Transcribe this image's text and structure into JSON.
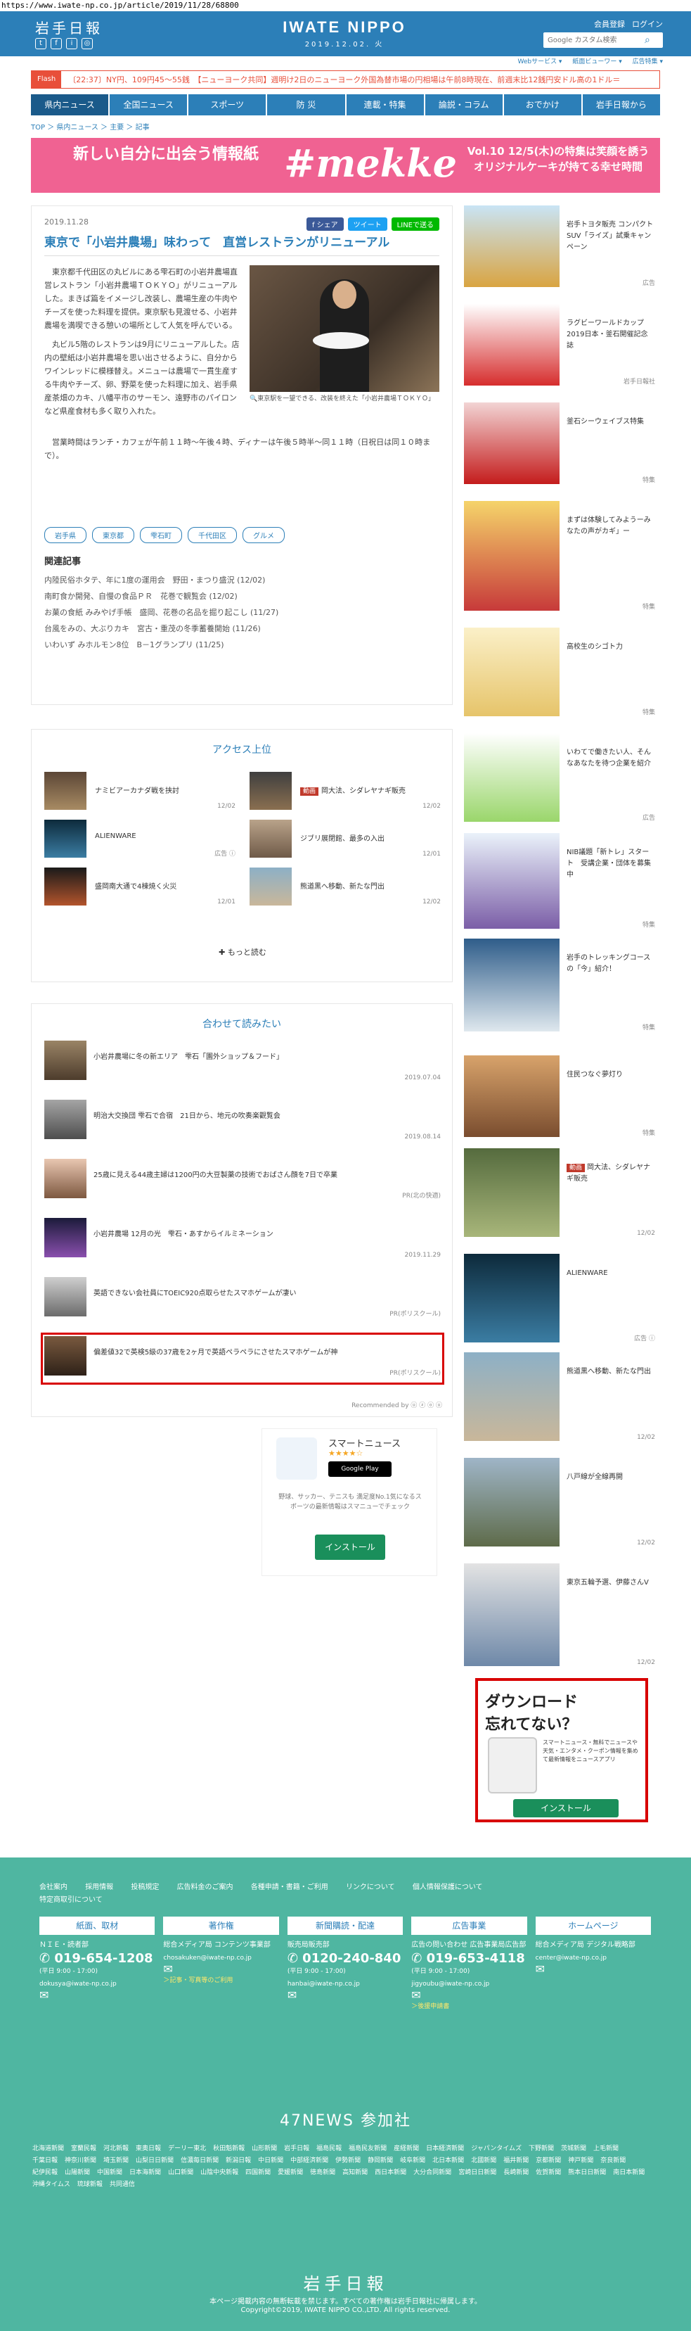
{
  "url": "https://www.iwate-np.co.jp/article/2019/11/28/68800",
  "header": {
    "logo_jp": "岩手日報",
    "brand": "IWATE NIPPO",
    "date": "2019.12.02. 火",
    "member_register": "会員登録",
    "login": "ログイン",
    "search_placeholder": "Google カスタム検索",
    "social": [
      "t",
      "f",
      "i",
      "◎"
    ]
  },
  "topline": [
    "Webサービス ▾",
    "紙面ビューワー ▾",
    "広告特集 ▾"
  ],
  "flash": {
    "tag": "Flash",
    "text": "〔22:37〕NY円、109円45～55銭　【ニューヨーク共同】週明け2日のニューヨーク外国為替市場の円相場は午前8時現在、前週末比12銭円安ドル高の1ドル＝"
  },
  "nav": [
    "県内ニュース",
    "全国ニュース",
    "スポーツ",
    "防 災",
    "連載・特集",
    "論説・コラム",
    "おでかけ",
    "岩手日報から"
  ],
  "breadcrumb": "TOP ＞ 県内ニュース ＞ 主要 ＞ 記事",
  "banner": {
    "left": "新しい自分に出会う情報紙",
    "mid": "#mekke",
    "right": "Vol.10 12/5(木)の特集は笑顔を誘うオリジナルケーキが持てる幸せ時間"
  },
  "article": {
    "date": "2019.11.28",
    "share": [
      "f シェア",
      "ツイート",
      "LINEで送る"
    ],
    "title": "東京で「小岩井農場」味わって　直営レストランがリニューアル",
    "paragraphs": [
      "東京都千代田区の丸ビルにある雫石町の小岩井農場直営レストラン「小岩井農場ＴＯＫＹＯ」がリニューアルした。まきば篇をイメージし改装し、農場生産の牛肉やチーズを使った料理を提供。東京駅も見渡せる、小岩井農場を満喫できる憩いの場所として人気を呼んでいる。",
      "丸ビル5階のレストランは9月にリニューアルした。店内の壁紙は小岩井農場を思い出させるように、自分からワインレッドに模様替え。メニューは農場で一貫生産する牛肉やチーズ、卵、野菜を使った料理に加え、岩手県産茶畑のカキ、八幡平市のサーモン、遠野市のパイロンなど県産食材も多く取り入れた。"
    ],
    "paragraph3": "営業時間はランチ・カフェが午前１１時～午後４時、ディナーは午後５時半～同１１時（日祝日は同１０時まで）。",
    "caption": "東京駅を一望できる、改装を終えた「小岩井農場ＴＯＫＹＯ」",
    "tags": [
      "岩手県",
      "東京都",
      "雫石町",
      "千代田区",
      "グルメ"
    ],
    "related_heading": "関連記事",
    "related": [
      "内陸民俗ホタテ、年に1度の運用会　野田・まつり盛況 (12/02)",
      "南町食か開発、自慢の食品ＰＲ　花巻で観覧会 (12/02)",
      "お菓の食紙 みみやげ手帳　盛岡、花巻の名品を掘り起こし (11/27)",
      "台風をみの、大ぶりカキ　宮古・重茂の冬季蓄養開始 (11/26)",
      "いわいず みホルモン8位　B－1グランプリ (11/25)"
    ]
  },
  "access": {
    "title": "アクセス上位",
    "items": [
      {
        "text": "ナミビアーカナダ戦を挟討",
        "date": "12/02",
        "hot": ""
      },
      {
        "text": "岡大法、シダレヤナギ販売",
        "date": "12/02",
        "hot": "動画"
      },
      {
        "text": "ALIENWARE",
        "date": "広告 ⓘ",
        "hot": ""
      },
      {
        "text": "ジブリ展閉館、最多の入出",
        "date": "12/01",
        "hot": ""
      },
      {
        "text": "盛岡南大通で4棟焼く火災",
        "date": "12/01",
        "hot": ""
      },
      {
        "text": "熊道黒へ移動、新たな門出",
        "date": "12/02",
        "hot": ""
      }
    ],
    "more": "✚ もっと読む"
  },
  "together": {
    "title": "合わせて読みたい",
    "rows": [
      {
        "text": "小岩井農場に冬の新エリア　雫石「園外ショップ＆フード」",
        "date": "2019.07.04"
      },
      {
        "text": "明治大交換団 雫石で合宿　21日から、地元の吹奏楽觀覧会",
        "date": "2019.08.14"
      },
      {
        "text": "25歳に見える44歳主婦は1200円の大豆製薬の技術でおばさん顔を7日で卒業",
        "date": "PR(北の快適)"
      },
      {
        "text": "小岩井農場 12月の光　雫石・あすからイルミネーション",
        "date": "2019.11.29"
      },
      {
        "text": "英語できない会社員にTOEIC920点取らせたスマホゲームが凄い",
        "date": "PR(ポリスクール)"
      },
      {
        "text": "偏差値32で英検5級の37歳を2ヶ月で英語ペラペラにさせたスマホゲームが神",
        "date": "PR(ポリスクール)"
      }
    ],
    "recommended": "Recommended by ⓤ ⓩ ⓞ ⓤ"
  },
  "appad": {
    "name": "スマートニュース",
    "stars": "★★★★☆",
    "store": "Google Play",
    "desc": "野球、サッカー、テニスも 満足度No.1気になるスポーツの最新情報はスマニューでチェック",
    "install": "インストール"
  },
  "sidebar": [
    {
      "text": "岩手トヨタ販売 コンパクトSUV「ライズ」試乗キャンペーン",
      "src": "広告",
      "hot": ""
    },
    {
      "text": "ラグビーワールドカップ2019日本・釜石開催記念誌",
      "src": "岩手日報社",
      "hot": ""
    },
    {
      "text": "釜石シーウェイブス特集",
      "src": "特集",
      "hot": ""
    },
    {
      "text": "まずは体験してみようーみなたの声がカギ」ー",
      "src": "特集",
      "hot": ""
    },
    {
      "text": "高校生のシゴト力",
      "src": "特集",
      "hot": ""
    },
    {
      "text": "いわてで働きたい人、そんなあなたを待つ企業を紹介",
      "src": "広告",
      "hot": ""
    },
    {
      "text": "NIB議題「新トレ」スタート　受講企業・団体を募集中",
      "src": "特集",
      "hot": ""
    },
    {
      "text": "岩手のトレッキングコースの「今」紹介！",
      "src": "特集",
      "hot": ""
    },
    {
      "text": "住民つなぐ夢灯り",
      "src": "特集",
      "hot": ""
    },
    {
      "text": "岡大法、シダレヤナギ販売",
      "src": "12/02",
      "hot": "動画"
    },
    {
      "text": "ALIENWARE",
      "src": "広告 ⓘ",
      "hot": ""
    },
    {
      "text": "熊道黒へ移動、新たな門出",
      "src": "12/02",
      "hot": ""
    },
    {
      "text": "八戸線が全線再開",
      "src": "12/02",
      "hot": ""
    },
    {
      "text": "東京五輪予選、伊藤さんV",
      "src": "12/02",
      "hot": ""
    }
  ],
  "dlad": {
    "line1": "ダウンロード",
    "line2": "忘れてない？",
    "small": "スマートニュース・無料でニュースや天気・エンタメ・クーポン情報を集めて最新情報をニュースアプリ",
    "btn": "インストール"
  },
  "footer": {
    "links": [
      "会社案内",
      "採用情報",
      "投稿規定",
      "広告料金のご案内",
      "各種申請・書籍・ご利用",
      "リンクについて",
      "個人情報保護について",
      "特定商取引について"
    ],
    "cols": [
      {
        "head": "紙面、取材",
        "l1": "ＮＩＥ・読者部",
        "big": "019-654-1208",
        "hours": "(平日 9:00 - 17:00)",
        "mail": "dokusya@iwate-np.co.jp",
        "note": ""
      },
      {
        "head": "著作権",
        "l1": "総合メディア局 コンテンツ事業部",
        "big": "",
        "hours": "",
        "mail": "chosakuken@iwate-np.co.jp",
        "note": "＞記事・写真等のご利用"
      },
      {
        "head": "新聞購読・配達",
        "l1": "販売局販売部",
        "big": "0120-240-840",
        "hours": "(平日 9:00 - 17:00)",
        "mail": "hanbai@iwate-np.co.jp",
        "note": ""
      },
      {
        "head": "広告事業",
        "l1": "広告の問い合わせ 広告事業局広告部",
        "big": "019-653-4118",
        "hours": "(平日 9:00 - 17:00)",
        "mail": "jigyoubu@iwate-np.co.jp",
        "note": "＞後援申請書"
      },
      {
        "head": "ホームページ",
        "l1": "総合メディア局 デジタル戦略部",
        "big": "",
        "hours": "",
        "mail": "center@iwate-np.co.jp",
        "note": ""
      }
    ],
    "n47": "47NEWS 参加社",
    "papers": [
      "北海道新聞",
      "室蘭民報",
      "河北新報",
      "東奥日報",
      "デーリー東北",
      "秋田魁新報",
      "山形新聞",
      "岩手日報",
      "福島民報",
      "福島民友新聞",
      "産経新聞",
      "日本経済新聞",
      "ジャパンタイムズ",
      "下野新聞",
      "茨城新聞",
      "上毛新聞",
      "千葉日報",
      "神奈川新聞",
      "埼玉新聞",
      "山梨日日新聞",
      "信濃毎日新聞",
      "新潟日報",
      "中日新聞",
      "中部経済新聞",
      "伊勢新聞",
      "静岡新聞",
      "岐阜新聞",
      "北日本新聞",
      "北國新聞",
      "福井新聞",
      "京都新聞",
      "神戸新聞",
      "奈良新聞",
      "紀伊民報",
      "山陽新聞",
      "中国新聞",
      "日本海新聞",
      "山口新聞",
      "山陰中央新報",
      "四国新聞",
      "愛媛新聞",
      "徳島新聞",
      "高知新聞",
      "西日本新聞",
      "大分合同新聞",
      "宮崎日日新聞",
      "長崎新聞",
      "佐賀新聞",
      "熊本日日新聞",
      "南日本新聞",
      "沖縄タイムス",
      "琉球新報",
      "共同通信"
    ],
    "logo": "岩手日報",
    "notice": "本ページ掲載内容の無断転載を禁じます。すべての著作権は岩手日報社に帰属します。",
    "copyright": "Copyright©2019, IWATE NIPPO CO.,LTD. All rights reserved."
  }
}
